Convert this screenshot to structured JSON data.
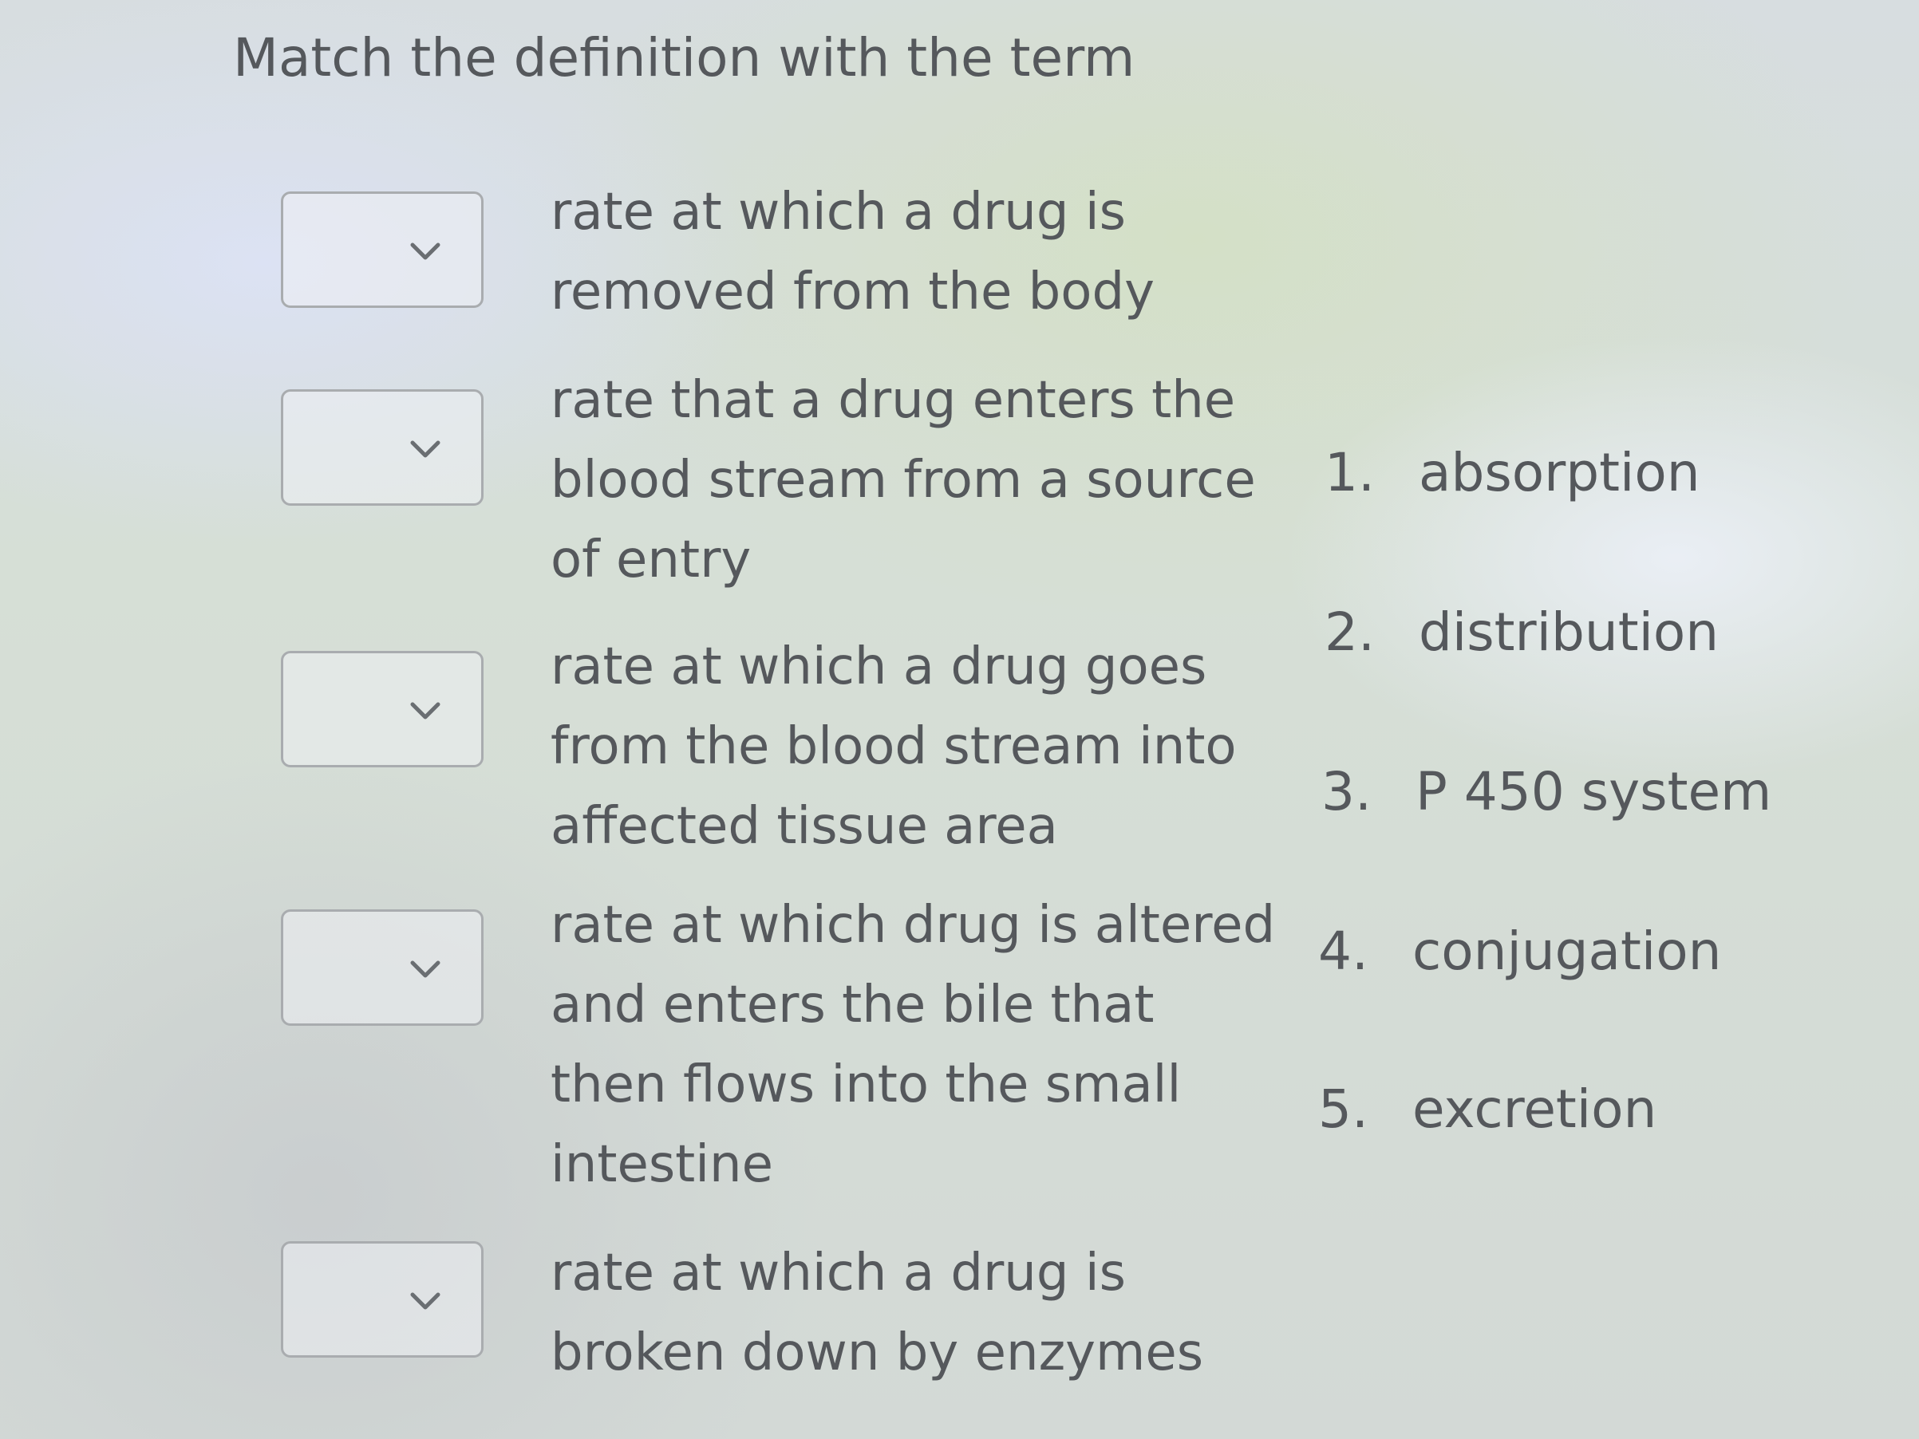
{
  "title": "Match the definition with the term",
  "definitions": [
    {
      "lines": [
        "rate at which a drug is",
        "removed from the body"
      ]
    },
    {
      "lines": [
        "rate that a drug enters the",
        "blood stream from a source",
        "of entry"
      ]
    },
    {
      "lines": [
        "rate at which a drug goes",
        "from the blood stream into",
        "affected tissue area"
      ]
    },
    {
      "lines": [
        "rate at which drug is altered",
        "and enters the bile that",
        "then flows into the small",
        "intestine"
      ]
    },
    {
      "lines": [
        "rate at which a drug is",
        "broken down by enzymes"
      ]
    }
  ],
  "terms": [
    {
      "number": "1.",
      "label": "absorption"
    },
    {
      "number": "2.",
      "label": "distribution"
    },
    {
      "number": "3.",
      "label": "P 450 system"
    },
    {
      "number": "4.",
      "label": "conjugation"
    },
    {
      "number": "5.",
      "label": "excretion"
    }
  ],
  "icons": {
    "dropdown": "chevron-down-icon"
  }
}
